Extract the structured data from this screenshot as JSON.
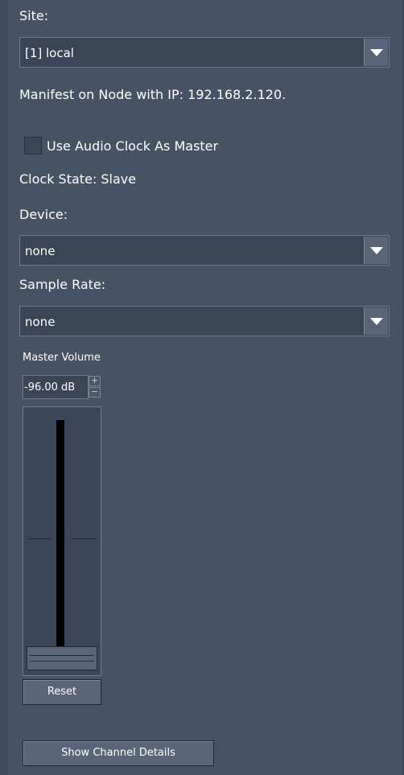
{
  "site": {
    "label": "Site:",
    "selected": "[1] local"
  },
  "manifest_text": "Manifest on Node with IP: 192.168.2.120.",
  "audio_clock": {
    "label": "Use Audio Clock As Master",
    "checked": false
  },
  "clock_state": "Clock State: Slave",
  "device": {
    "label": "Device:",
    "selected": "none"
  },
  "sample_rate": {
    "label": "Sample Rate:",
    "selected": "none"
  },
  "master_volume": {
    "label": "Master Volume",
    "value": "-96.00 dB",
    "stepper_up": "+",
    "stepper_down": "−"
  },
  "buttons": {
    "reset": "Reset",
    "show_channel_details": "Show Channel Details"
  }
}
